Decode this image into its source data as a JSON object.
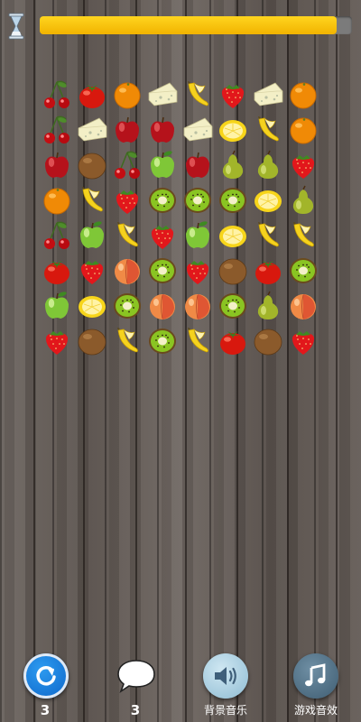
{
  "timer": {
    "progress": 0.95,
    "fill_color": "#f6c40a"
  },
  "board": {
    "columns": 8,
    "rows": [
      [
        "cherry",
        "tomato",
        "orange",
        "cheese",
        "banana",
        "strawberry",
        "cheese",
        "orange"
      ],
      [
        "cherry",
        "cheese",
        "red-apple",
        "red-apple",
        "cheese",
        "lemon",
        "banana",
        "orange"
      ],
      [
        "red-apple",
        "kiwi-whole",
        "cherry",
        "green-apple",
        "red-apple",
        "pear",
        "pear",
        "strawberry"
      ],
      [
        "orange",
        "banana",
        "strawberry",
        "kiwi",
        "kiwi",
        "kiwi",
        "lemon",
        "pear"
      ],
      [
        "cherry",
        "green-apple",
        "banana",
        "strawberry",
        "green-apple",
        "lemon",
        "banana",
        "banana"
      ],
      [
        "tomato",
        "strawberry",
        "peach",
        "kiwi",
        "strawberry",
        "kiwi-whole",
        "tomato",
        "kiwi"
      ],
      [
        "green-apple",
        "lemon",
        "kiwi",
        "peach",
        "peach",
        "kiwi",
        "pear",
        "peach"
      ],
      [
        "strawberry",
        "kiwi-whole",
        "banana",
        "kiwi",
        "banana",
        "tomato",
        "kiwi-whole",
        "strawberry"
      ]
    ]
  },
  "footer": {
    "refresh": {
      "icon": "refresh-icon",
      "count": "3"
    },
    "hint": {
      "icon": "speech-bubble-icon",
      "count": "3"
    },
    "music": {
      "icon": "speaker-icon",
      "label": "背景音乐"
    },
    "sound": {
      "icon": "music-note-icon",
      "label": "游戏音效"
    }
  }
}
